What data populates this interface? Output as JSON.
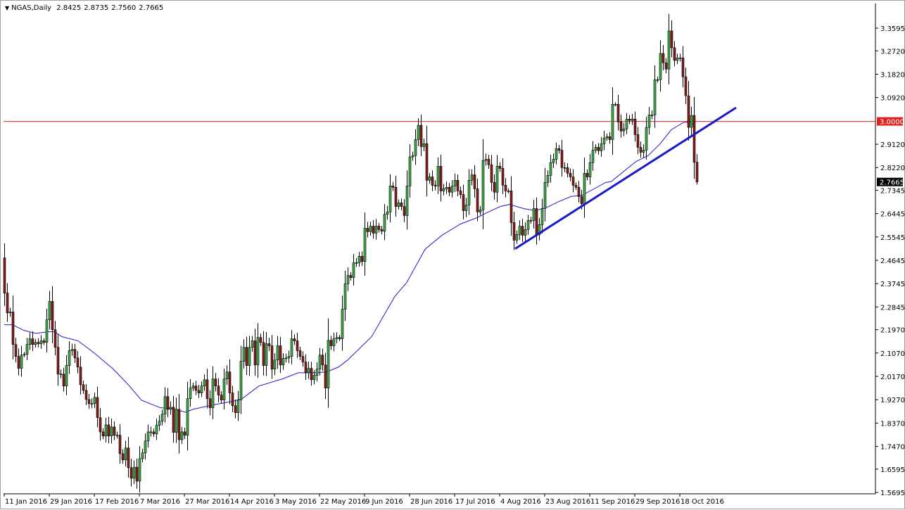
{
  "header": {
    "symbol": "NGAS,Daily",
    "open": "2.8425",
    "high": "2.8735",
    "low": "2.7560",
    "close": "2.7665"
  },
  "colors": {
    "bull": "#3fae49",
    "bear": "#8b1c1c",
    "ma": "#1c1ccc",
    "trendline": "#1a1acc",
    "level": "#e0201c",
    "current_price_bg": "#000000"
  },
  "chart_data": {
    "type": "candlestick",
    "title": "NGAS,Daily",
    "ylim": [
      1.5642,
      3.4545
    ],
    "x_tick_labels": [
      "11 Jan 2016",
      "29 Jan 2016",
      "17 Feb 2016",
      "7 Mar 2016",
      "27 Mar 2016",
      "14 Apr 2016",
      "3 May 2016",
      "22 May 2016",
      "9 Jun 2016",
      "28 Jun 2016",
      "17 Jul 2016",
      "4 Aug 2016",
      "23 Aug 2016",
      "11 Sep 2016",
      "29 Sep 2016",
      "18 Oct 2016"
    ],
    "x_tick_every_bars": 16,
    "y_tick_labels": [
      "3.3595",
      "3.2720",
      "3.1820",
      "3.0920",
      "2.9120",
      "2.8220",
      "2.7345",
      "2.6445",
      "2.5545",
      "2.4645",
      "2.3745",
      "2.2845",
      "2.1970",
      "2.1070",
      "2.0170",
      "1.9270",
      "1.8370",
      "1.7470",
      "1.6595",
      "1.5695"
    ],
    "first_open": 2.474,
    "last_bar": {
      "open": 2.8425,
      "high": 2.8735,
      "low": 2.756,
      "close": 2.7665
    },
    "closes": [
      2.338,
      2.262,
      2.265,
      2.14,
      2.094,
      2.048,
      2.099,
      2.102,
      2.14,
      2.162,
      2.14,
      2.148,
      2.143,
      2.154,
      2.148,
      2.235,
      2.306,
      2.197,
      2.129,
      2.026,
      2.026,
      1.98,
      2.059,
      2.116,
      2.121,
      2.088,
      2.053,
      1.985,
      1.963,
      1.928,
      1.912,
      1.912,
      1.936,
      1.858,
      1.803,
      1.787,
      1.83,
      1.787,
      1.822,
      1.79,
      1.79,
      1.719,
      1.695,
      1.741,
      1.665,
      1.624,
      1.667,
      1.613,
      1.7,
      1.722,
      1.768,
      1.803,
      1.803,
      1.795,
      1.828,
      1.844,
      1.871,
      1.939,
      1.89,
      1.898,
      1.801,
      1.89,
      1.773,
      1.803,
      1.79,
      1.931,
      1.972,
      1.98,
      1.963,
      1.953,
      1.98,
      2.004,
      1.931,
      1.896,
      2.007,
      1.98,
      1.945,
      1.926,
      2.007,
      2.034,
      1.953,
      1.904,
      1.877,
      1.926,
      2.075,
      2.129,
      2.059,
      2.129,
      2.154,
      2.061,
      2.167,
      2.148,
      2.059,
      2.143,
      2.135,
      2.045,
      2.08,
      2.135,
      2.061,
      2.086,
      2.088,
      2.094,
      2.162,
      2.154,
      2.116,
      2.094,
      2.072,
      2.031,
      2.048,
      2.004,
      2.021,
      2.045,
      2.099,
      2.061,
      1.972,
      2.156,
      2.135,
      2.162,
      2.167,
      2.162,
      2.276,
      2.374,
      2.406,
      2.398,
      2.455,
      2.455,
      2.48,
      2.46,
      2.588,
      2.575,
      2.596,
      2.569,
      2.596,
      2.583,
      2.577,
      2.642,
      2.651,
      2.751,
      2.746,
      2.672,
      2.686,
      2.672,
      2.637,
      2.751,
      2.863,
      2.868,
      2.93,
      2.985,
      2.903,
      2.914,
      2.773,
      2.786,
      2.754,
      2.751,
      2.827,
      2.732,
      2.74,
      2.746,
      2.727,
      2.751,
      2.773,
      2.732,
      2.718,
      2.656,
      2.678,
      2.773,
      2.794,
      2.74,
      2.651,
      2.659,
      2.849,
      2.854,
      2.833,
      2.765,
      2.727,
      2.827,
      2.819,
      2.754,
      2.732,
      2.732,
      2.61,
      2.542,
      2.564,
      2.596,
      2.561,
      2.583,
      2.618,
      2.618,
      2.664,
      2.564,
      2.602,
      2.664,
      2.765,
      2.792,
      2.841,
      2.854,
      2.895,
      2.889,
      2.822,
      2.822,
      2.8,
      2.786,
      2.754,
      2.746,
      2.71,
      2.683,
      2.8,
      2.786,
      2.841,
      2.889,
      2.9,
      2.887,
      2.914,
      2.936,
      2.941,
      2.93,
      3.066,
      3.066,
      2.998,
      2.963,
      2.971,
      3.009,
      3.004,
      3.009,
      2.949,
      2.9,
      2.881,
      2.889,
      2.977,
      3.025,
      3.025,
      3.161,
      3.161,
      3.262,
      3.226,
      3.202,
      3.349,
      3.284,
      3.235,
      3.245,
      3.245,
      3.172,
      3.099,
      2.977,
      3.023,
      2.8425,
      2.7665
    ],
    "moving_average": [
      [
        0,
        2.216
      ],
      [
        3,
        2.216
      ],
      [
        7,
        2.194
      ],
      [
        11.25,
        2.183
      ],
      [
        15.5,
        2.189
      ],
      [
        18,
        2.189
      ],
      [
        20.5,
        2.17
      ],
      [
        26.25,
        2.154
      ],
      [
        32,
        2.107
      ],
      [
        38.75,
        2.045
      ],
      [
        44.5,
        1.98
      ],
      [
        48.75,
        1.925
      ],
      [
        55.5,
        1.896
      ],
      [
        59.5,
        1.893
      ],
      [
        64.5,
        1.879
      ],
      [
        67,
        1.89
      ],
      [
        73.75,
        1.906
      ],
      [
        82,
        1.923
      ],
      [
        84.5,
        1.931
      ],
      [
        90.5,
        1.98
      ],
      [
        98.75,
        2.007
      ],
      [
        104.5,
        2.031
      ],
      [
        110.5,
        2.031
      ],
      [
        114.5,
        2.034
      ],
      [
        118.75,
        2.053
      ],
      [
        122,
        2.08
      ],
      [
        130.5,
        2.17
      ],
      [
        138.75,
        2.325
      ],
      [
        143,
        2.379
      ],
      [
        149.5,
        2.507
      ],
      [
        155.5,
        2.561
      ],
      [
        162,
        2.604
      ],
      [
        168,
        2.629
      ],
      [
        172,
        2.651
      ],
      [
        176.25,
        2.672
      ],
      [
        179.5,
        2.68
      ],
      [
        184.5,
        2.664
      ],
      [
        188.75,
        2.656
      ],
      [
        193,
        2.67
      ],
      [
        197,
        2.691
      ],
      [
        201.25,
        2.71
      ],
      [
        205.5,
        2.716
      ],
      [
        213.75,
        2.765
      ],
      [
        215.5,
        2.767
      ],
      [
        224.5,
        2.846
      ],
      [
        228.75,
        2.868
      ],
      [
        233,
        2.914
      ],
      [
        237,
        2.968
      ],
      [
        241.25,
        2.996
      ],
      [
        243.75,
        2.998
      ],
      [
        245.5,
        2.985
      ]
    ],
    "trendline": {
      "from": [
        181.5,
        2.509
      ],
      "to": [
        260,
        3.053
      ]
    },
    "horizontal_level": {
      "price": 3.0,
      "label": "3.0000"
    },
    "current_price": {
      "price": 2.7665,
      "label": "2.7665"
    }
  }
}
